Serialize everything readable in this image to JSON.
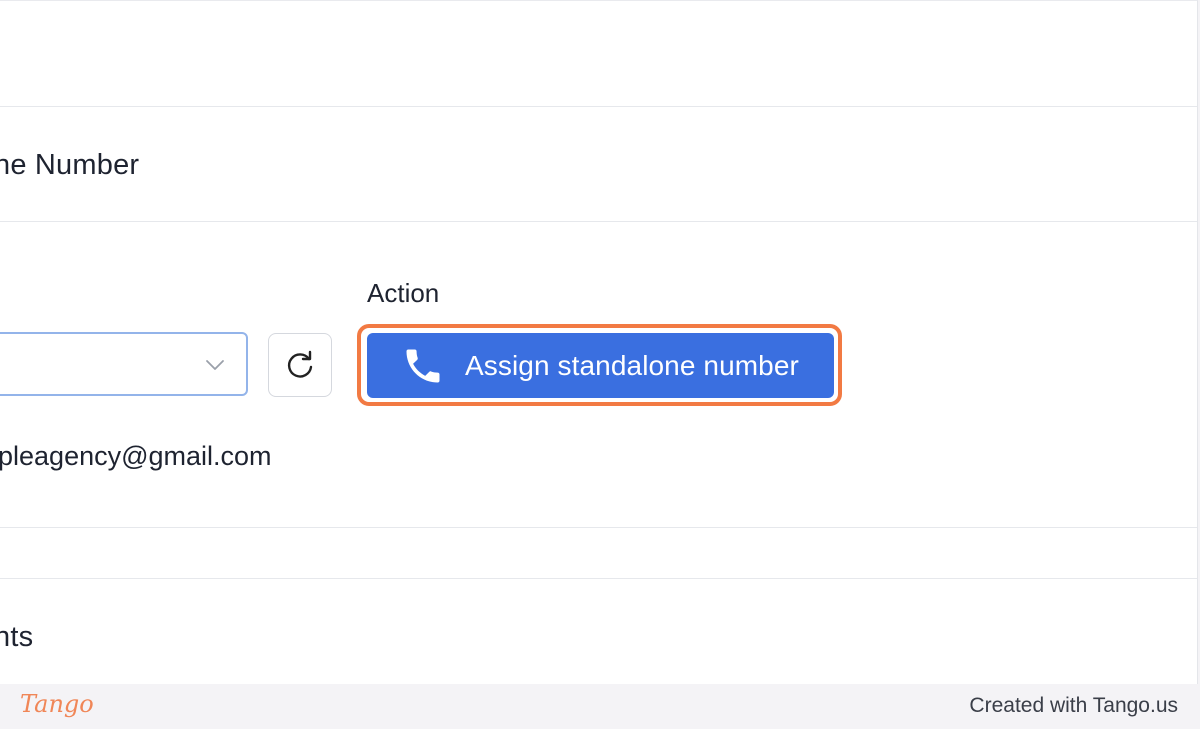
{
  "section_phone": {
    "title": "ne Number"
  },
  "action": {
    "label": "Action",
    "assign_button": {
      "label": "Assign standalone number",
      "icon": "phone-icon"
    },
    "refresh_button": {
      "icon": "refresh-icon"
    }
  },
  "select": {
    "value": "",
    "icon": "chevron-down-icon"
  },
  "email": {
    "text": "pleagency@gmail.com"
  },
  "section_bottom": {
    "title": "nts"
  },
  "footer": {
    "logo": "Tango",
    "credit": "Created with Tango.us"
  },
  "colors": {
    "accent": "#3a6fe0",
    "highlight": "#f27a43",
    "logo": "#f08657"
  }
}
